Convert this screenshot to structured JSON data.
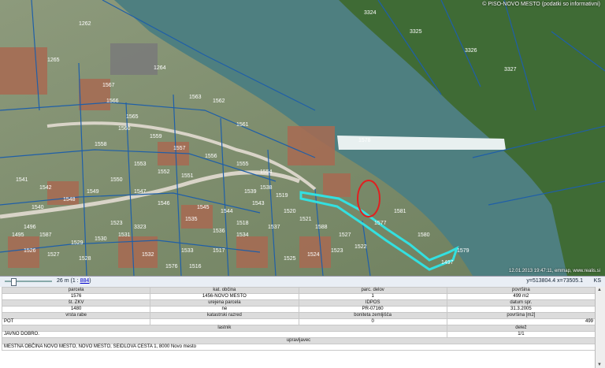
{
  "map": {
    "credit": "© PISO-NOVO MESTO (podatki so informativni)",
    "timestamp": "12.01.2013 19:47:11, emmap, www.realis.si",
    "weir_label": "1578",
    "parcel_labels": [
      "1262",
      "1265",
      "1264",
      "1567",
      "1566",
      "1565",
      "1563",
      "1562",
      "1561",
      "1560",
      "1559",
      "1558",
      "1557",
      "1556",
      "1555",
      "1554",
      "1553",
      "1552",
      "1551",
      "1550",
      "1549",
      "1548",
      "1547",
      "1546",
      "1545",
      "1544",
      "1543",
      "1542",
      "1541",
      "1540",
      "1539",
      "1538",
      "1537",
      "1536",
      "1535",
      "1534",
      "1533",
      "1532",
      "1531",
      "1530",
      "1529",
      "1528",
      "1527",
      "1526",
      "1525",
      "1524",
      "1523",
      "1522",
      "1521",
      "1520",
      "1519",
      "1518",
      "1517",
      "1516",
      "1576",
      "1577",
      "1579",
      "1580",
      "1581",
      "1497",
      "1496",
      "1495",
      "1587",
      "1588",
      "1527",
      "1523",
      "3323",
      "3324",
      "3325",
      "3326",
      "3327"
    ],
    "colors": {
      "water": "#4e7f80",
      "land": "#7a8a6a",
      "parcel_line": "#1f5fa8",
      "selected": "#33e0e0",
      "marker": "#e02020"
    }
  },
  "scalebar": {
    "scale_label": "26 m",
    "ratio_prefix": "(1 :",
    "ratio_value": "884",
    "ratio_suffix": ")",
    "coords": "y=513804.4   x=73505.1",
    "crs": "KS"
  },
  "info": {
    "row1": {
      "headers": [
        "parcela",
        "kat. občina",
        "parc. delov",
        "površina"
      ],
      "values": [
        "1576",
        "1456-NOVO MESTO",
        "1",
        "499 m2"
      ]
    },
    "row2": {
      "headers": [
        "št. ZKV",
        "urejena parcela",
        "IDPOS",
        "datum spr."
      ],
      "values": [
        "1480",
        "ne",
        "PR-07160",
        "31.3.2005"
      ]
    },
    "row3": {
      "headers": [
        "vrsta rabe",
        "katastrski razred",
        "boniteta zemljišča",
        "površina [m2]"
      ],
      "values": [
        "POT",
        "",
        "0",
        "499"
      ]
    },
    "owner": {
      "headers": [
        "lastnik",
        "delež"
      ],
      "values": [
        "JAVNO DOBRO.",
        "1/1"
      ]
    },
    "admin": {
      "header": "upravljavec",
      "value": "MESTNA OBČINA NOVO MESTO, NOVO MESTO, SEIDLOVA CESTA 1, 8000 Novo mesto"
    }
  }
}
